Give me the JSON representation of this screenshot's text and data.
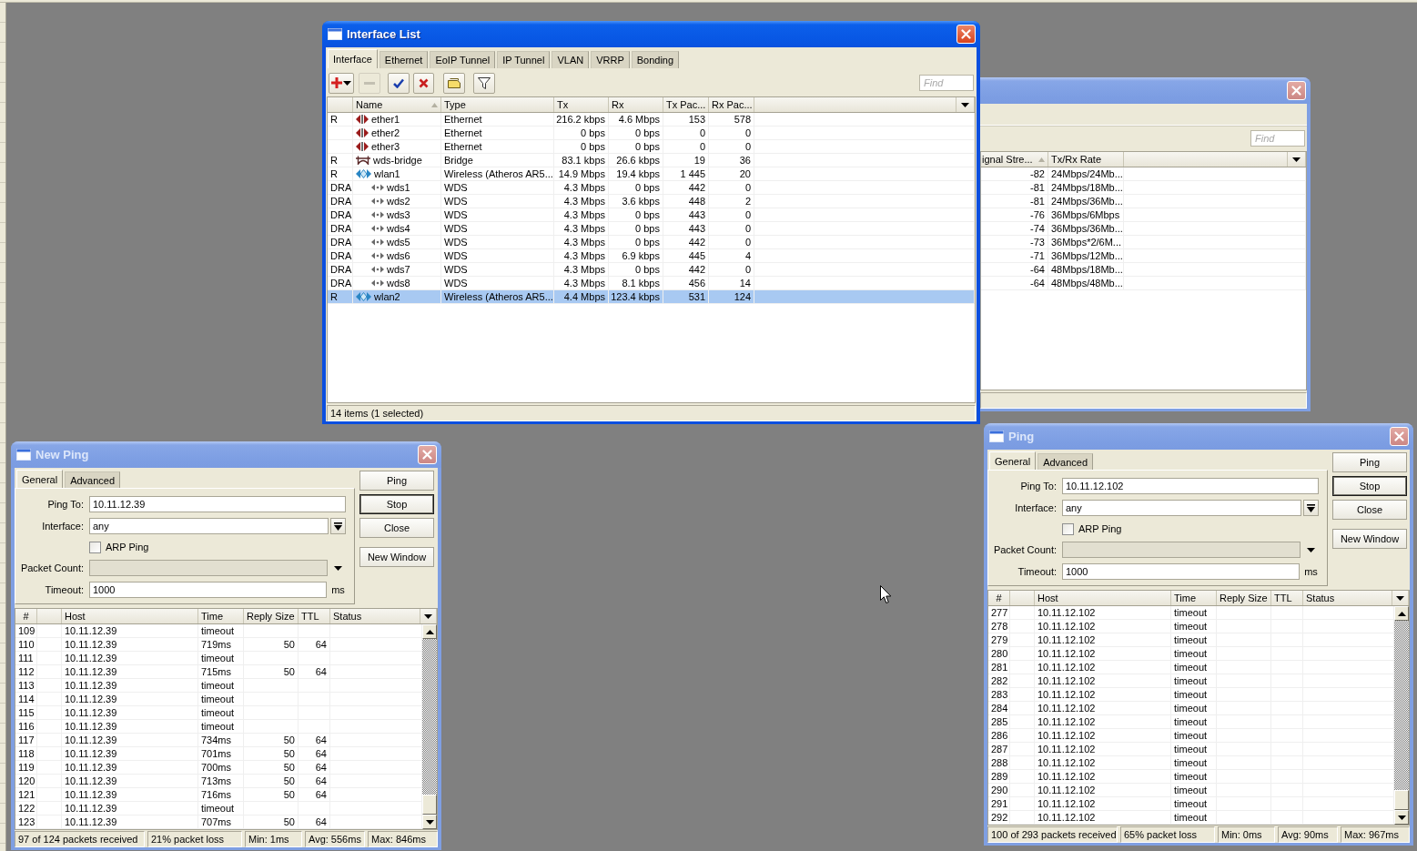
{
  "interface_list": {
    "title": "Interface List",
    "active": true,
    "tabs": [
      {
        "label": "Interface",
        "selected": true
      },
      {
        "label": "Ethernet",
        "selected": false
      },
      {
        "label": "EoIP Tunnel",
        "selected": false
      },
      {
        "label": "IP Tunnel",
        "selected": false
      },
      {
        "label": "VLAN",
        "selected": false
      },
      {
        "label": "VRRP",
        "selected": false
      },
      {
        "label": "Bonding",
        "selected": false
      }
    ],
    "toolbar": [
      {
        "kind": "add",
        "disabled": false
      },
      {
        "kind": "remove",
        "disabled": true
      },
      {
        "kind": "enable",
        "disabled": false
      },
      {
        "kind": "disable",
        "disabled": false
      },
      {
        "kind": "comment",
        "disabled": false
      },
      {
        "kind": "filter",
        "disabled": false
      }
    ],
    "find": {
      "placeholder": "Find"
    },
    "columns": [
      {
        "label": "Name",
        "sorted": true
      },
      {
        "label": "Type",
        "sorted": false
      },
      {
        "label": "Tx",
        "sorted": false
      },
      {
        "label": "Rx",
        "sorted": false
      },
      {
        "label": "Tx Pac...",
        "sorted": false
      },
      {
        "label": "Rx Pac...",
        "sorted": false
      }
    ],
    "rows": [
      {
        "flags": "R",
        "kind": "ethernet",
        "name": "ether1",
        "type": "Ethernet",
        "tx": "216.2 kbps",
        "rx": "4.6 Mbps",
        "tx_packets": "153",
        "rx_packets": "578",
        "selected": false
      },
      {
        "kind": "ethernet",
        "name": "ether2",
        "type": "Ethernet",
        "tx": "0 bps",
        "rx": "0 bps",
        "tx_packets": "0",
        "rx_packets": "0",
        "selected": false
      },
      {
        "kind": "ethernet",
        "name": "ether3",
        "type": "Ethernet",
        "tx": "0 bps",
        "rx": "0 bps",
        "tx_packets": "0",
        "rx_packets": "0",
        "selected": false
      },
      {
        "flags": "R",
        "kind": "bridge",
        "name": "wds-bridge",
        "type": "Bridge",
        "tx": "83.1 kbps",
        "rx": "26.6 kbps",
        "tx_packets": "19",
        "rx_packets": "36",
        "selected": false
      },
      {
        "flags": "R",
        "kind": "wireless",
        "name": "wlan1",
        "type": "Wireless (Atheros AR5...",
        "tx": "14.9 Mbps",
        "rx": "19.4 kbps",
        "tx_packets": "1 445",
        "rx_packets": "20",
        "selected": false,
        "children": [
          {
            "flags": "DRA",
            "kind": "wds",
            "name": "wds1",
            "type": "WDS",
            "tx": "4.3 Mbps",
            "rx": "0 bps",
            "tx_packets": "442",
            "rx_packets": "0",
            "selected": false
          },
          {
            "flags": "DRA",
            "kind": "wds",
            "name": "wds2",
            "type": "WDS",
            "tx": "4.3 Mbps",
            "rx": "3.6 kbps",
            "tx_packets": "448",
            "rx_packets": "2",
            "selected": false
          },
          {
            "flags": "DRA",
            "kind": "wds",
            "name": "wds3",
            "type": "WDS",
            "tx": "4.3 Mbps",
            "rx": "0 bps",
            "tx_packets": "443",
            "rx_packets": "0",
            "selected": false
          },
          {
            "flags": "DRA",
            "kind": "wds",
            "name": "wds4",
            "type": "WDS",
            "tx": "4.3 Mbps",
            "rx": "0 bps",
            "tx_packets": "443",
            "rx_packets": "0",
            "selected": false
          },
          {
            "flags": "DRA",
            "kind": "wds",
            "name": "wds5",
            "type": "WDS",
            "tx": "4.3 Mbps",
            "rx": "0 bps",
            "tx_packets": "442",
            "rx_packets": "0",
            "selected": false
          },
          {
            "flags": "DRA",
            "kind": "wds",
            "name": "wds6",
            "type": "WDS",
            "tx": "4.3 Mbps",
            "rx": "6.9 kbps",
            "tx_packets": "445",
            "rx_packets": "4",
            "selected": false
          },
          {
            "flags": "DRA",
            "kind": "wds",
            "name": "wds7",
            "type": "WDS",
            "tx": "4.3 Mbps",
            "rx": "0 bps",
            "tx_packets": "442",
            "rx_packets": "0",
            "selected": false
          },
          {
            "flags": "DRA",
            "kind": "wds",
            "name": "wds8",
            "type": "WDS",
            "tx": "4.3 Mbps",
            "rx": "8.1 kbps",
            "tx_packets": "456",
            "rx_packets": "14",
            "selected": false
          }
        ]
      },
      {
        "flags": "R",
        "kind": "wireless",
        "name": "wlan2",
        "type": "Wireless (Atheros AR5...",
        "tx": "4.4 Mbps",
        "rx": "123.4 kbps",
        "tx_packets": "531",
        "rx_packets": "124",
        "selected": true
      }
    ],
    "status": "14 items (1 selected)"
  },
  "background_window": {
    "active": false,
    "find": {
      "placeholder": "Find"
    },
    "columns": [
      {
        "label": "ignal Stre...",
        "sorted": true
      },
      {
        "label": "Tx/Rx Rate",
        "sorted": false
      }
    ],
    "rows": [
      {
        "signal_strength": "-82",
        "tx_rx_rate": "24Mbps/24Mb..."
      },
      {
        "signal_strength": "-81",
        "tx_rx_rate": "24Mbps/18Mb..."
      },
      {
        "signal_strength": "-81",
        "tx_rx_rate": "24Mbps/36Mb..."
      },
      {
        "signal_strength": "-76",
        "tx_rx_rate": "36Mbps/6Mbps"
      },
      {
        "signal_strength": "-74",
        "tx_rx_rate": "36Mbps/36Mb..."
      },
      {
        "signal_strength": "-73",
        "tx_rx_rate": "36Mbps*2/6M..."
      },
      {
        "signal_strength": "-71",
        "tx_rx_rate": "36Mbps/12Mb..."
      },
      {
        "signal_strength": "-64",
        "tx_rx_rate": "48Mbps/18Mb..."
      },
      {
        "signal_strength": "-64",
        "tx_rx_rate": "48Mbps/48Mb..."
      }
    ]
  },
  "ping_windows": [
    {
      "title": "New Ping",
      "active": false,
      "tabs": [
        {
          "label": "General",
          "selected": true
        },
        {
          "label": "Advanced",
          "selected": false
        }
      ],
      "ping_to": {
        "label": "Ping To:",
        "value": "10.11.12.39"
      },
      "interface": {
        "label": "Interface:",
        "value": "any"
      },
      "arp_ping": {
        "label": "ARP Ping",
        "checked": false
      },
      "packet_count": {
        "label": "Packet Count:",
        "disabled": true
      },
      "timeout": {
        "label": "Timeout:",
        "value": "1000",
        "unit": "ms"
      },
      "buttons": [
        {
          "label": "Ping",
          "default": false
        },
        {
          "label": "Stop",
          "default": true
        },
        {
          "label": "Close",
          "default": false
        },
        {
          "label": "New Window",
          "default": false
        }
      ],
      "columns": [
        "#",
        "Host",
        "Time",
        "Reply Size",
        "TTL",
        "Status"
      ],
      "rows": [
        {
          "number": "109",
          "host": "10.11.12.39",
          "time": "timeout"
        },
        {
          "number": "110",
          "host": "10.11.12.39",
          "time": "719ms",
          "reply_size": "50",
          "ttl": "64"
        },
        {
          "number": "111",
          "host": "10.11.12.39",
          "time": "timeout"
        },
        {
          "number": "112",
          "host": "10.11.12.39",
          "time": "715ms",
          "reply_size": "50",
          "ttl": "64"
        },
        {
          "number": "113",
          "host": "10.11.12.39",
          "time": "timeout"
        },
        {
          "number": "114",
          "host": "10.11.12.39",
          "time": "timeout"
        },
        {
          "number": "115",
          "host": "10.11.12.39",
          "time": "timeout"
        },
        {
          "number": "116",
          "host": "10.11.12.39",
          "time": "timeout"
        },
        {
          "number": "117",
          "host": "10.11.12.39",
          "time": "734ms",
          "reply_size": "50",
          "ttl": "64"
        },
        {
          "number": "118",
          "host": "10.11.12.39",
          "time": "701ms",
          "reply_size": "50",
          "ttl": "64"
        },
        {
          "number": "119",
          "host": "10.11.12.39",
          "time": "700ms",
          "reply_size": "50",
          "ttl": "64"
        },
        {
          "number": "120",
          "host": "10.11.12.39",
          "time": "713ms",
          "reply_size": "50",
          "ttl": "64"
        },
        {
          "number": "121",
          "host": "10.11.12.39",
          "time": "716ms",
          "reply_size": "50",
          "ttl": "64"
        },
        {
          "number": "122",
          "host": "10.11.12.39",
          "time": "timeout"
        },
        {
          "number": "123",
          "host": "10.11.12.39",
          "time": "707ms",
          "reply_size": "50",
          "ttl": "64"
        }
      ],
      "status": [
        "97 of 124 packets received",
        "21% packet loss",
        "Min: 1ms",
        "Avg: 556ms",
        "Max: 846ms"
      ]
    },
    {
      "title": "Ping",
      "active": false,
      "tabs": [
        {
          "label": "General",
          "selected": true
        },
        {
          "label": "Advanced",
          "selected": false
        }
      ],
      "ping_to": {
        "label": "Ping To:",
        "value": "10.11.12.102"
      },
      "interface": {
        "label": "Interface:",
        "value": "any"
      },
      "arp_ping": {
        "label": "ARP Ping",
        "checked": false
      },
      "packet_count": {
        "label": "Packet Count:",
        "disabled": true
      },
      "timeout": {
        "label": "Timeout:",
        "value": "1000",
        "unit": "ms"
      },
      "buttons": [
        {
          "label": "Ping",
          "default": false
        },
        {
          "label": "Stop",
          "default": true
        },
        {
          "label": "Close",
          "default": false
        },
        {
          "label": "New Window",
          "default": false
        }
      ],
      "columns": [
        "#",
        "Host",
        "Time",
        "Reply Size",
        "TTL",
        "Status"
      ],
      "rows": [
        {
          "number": "277",
          "host": "10.11.12.102",
          "time": "timeout"
        },
        {
          "number": "278",
          "host": "10.11.12.102",
          "time": "timeout"
        },
        {
          "number": "279",
          "host": "10.11.12.102",
          "time": "timeout"
        },
        {
          "number": "280",
          "host": "10.11.12.102",
          "time": "timeout"
        },
        {
          "number": "281",
          "host": "10.11.12.102",
          "time": "timeout"
        },
        {
          "number": "282",
          "host": "10.11.12.102",
          "time": "timeout"
        },
        {
          "number": "283",
          "host": "10.11.12.102",
          "time": "timeout"
        },
        {
          "number": "284",
          "host": "10.11.12.102",
          "time": "timeout"
        },
        {
          "number": "285",
          "host": "10.11.12.102",
          "time": "timeout"
        },
        {
          "number": "286",
          "host": "10.11.12.102",
          "time": "timeout"
        },
        {
          "number": "287",
          "host": "10.11.12.102",
          "time": "timeout"
        },
        {
          "number": "288",
          "host": "10.11.12.102",
          "time": "timeout"
        },
        {
          "number": "289",
          "host": "10.11.12.102",
          "time": "timeout"
        },
        {
          "number": "290",
          "host": "10.11.12.102",
          "time": "timeout"
        },
        {
          "number": "291",
          "host": "10.11.12.102",
          "time": "timeout"
        },
        {
          "number": "292",
          "host": "10.11.12.102",
          "time": "timeout"
        }
      ],
      "status": [
        "100 of 293 packets received",
        "65% packet loss",
        "Min: 0ms",
        "Avg: 90ms",
        "Max: 967ms"
      ]
    }
  ]
}
